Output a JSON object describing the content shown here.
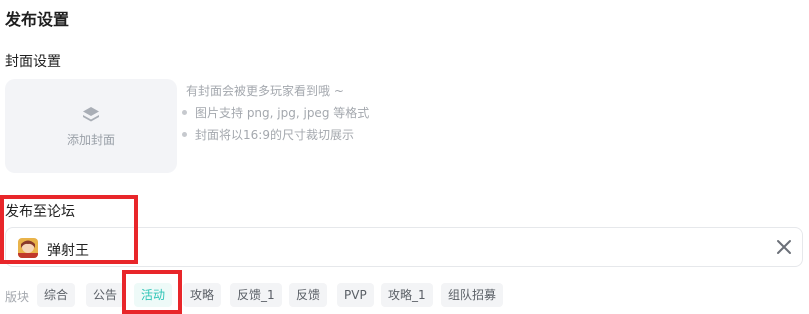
{
  "page_title": "发布设置",
  "cover": {
    "section_title": "封面设置",
    "add_label": "添加封面",
    "hint_main": "有封面会被更多玩家看到哦 ~",
    "hint_format": "图片支持 png, jpg, jpeg 等格式",
    "hint_crop": "封面将以16:9的尺寸裁切展示"
  },
  "forum": {
    "section_title": "发布至论坛",
    "selected_game": "弹射王"
  },
  "board": {
    "label": "版块",
    "tags": [
      "综合",
      "公告",
      "活动",
      "攻略",
      "反馈_1",
      "反馈",
      "PVP",
      "攻略_1",
      "组队招募"
    ],
    "active_tag": "活动"
  },
  "colors": {
    "accent": "#2ec4b6",
    "highlight_box": "#e8262a",
    "placeholder_bg": "#f3f4f7"
  }
}
